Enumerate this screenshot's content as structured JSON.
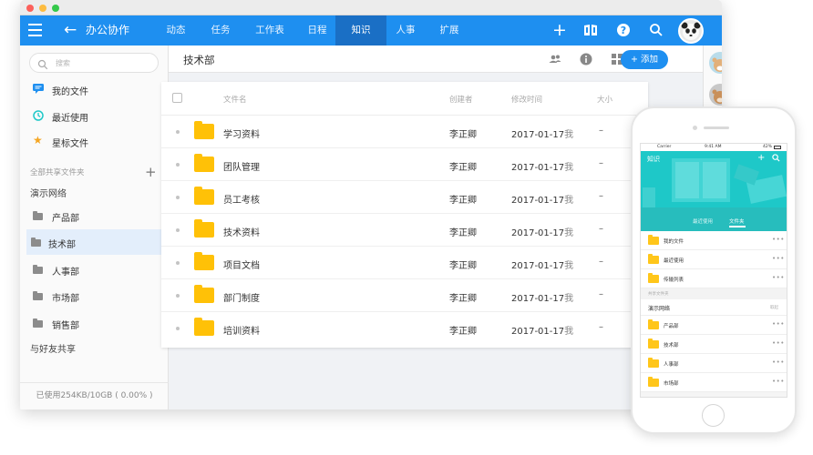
{
  "app": {
    "title": "办公协作",
    "nav_tabs": [
      {
        "label": "动态"
      },
      {
        "label": "任务"
      },
      {
        "label": "工作表"
      },
      {
        "label": "日程"
      },
      {
        "label": "知识",
        "active": true
      },
      {
        "label": "人事"
      },
      {
        "label": "扩展"
      }
    ],
    "accent_color": "#1e8ff0"
  },
  "sidebar": {
    "search_placeholder": "搜索",
    "quick_items": [
      {
        "label": "我的文件",
        "icon": "comment-icon"
      },
      {
        "label": "最近使用",
        "icon": "clock-icon"
      },
      {
        "label": "星标文件",
        "icon": "star-icon"
      }
    ],
    "shared_section_label": "全部共享文件夹",
    "network_label": "演示网络",
    "folders": [
      {
        "label": "产品部"
      },
      {
        "label": "技术部",
        "active": true
      },
      {
        "label": "人事部"
      },
      {
        "label": "市场部"
      },
      {
        "label": "销售部"
      }
    ],
    "friends_label": "与好友共享",
    "storage": "已使用254KB/10GB ( 0.00% )"
  },
  "content": {
    "folder_title": "技术部",
    "add_button": "添加",
    "columns": {
      "name": "文件名",
      "creator": "创建者",
      "modified": "修改时间",
      "size": "大小"
    },
    "rows": [
      {
        "name": "学习资料",
        "creator": "李正卿",
        "date": "2017-01-17",
        "by": "我",
        "size": "–"
      },
      {
        "name": "团队管理",
        "creator": "李正卿",
        "date": "2017-01-17",
        "by": "我",
        "size": "–"
      },
      {
        "name": "员工考核",
        "creator": "李正卿",
        "date": "2017-01-17",
        "by": "我",
        "size": "–"
      },
      {
        "name": "技术资料",
        "creator": "李正卿",
        "date": "2017-01-17",
        "by": "我",
        "size": "–"
      },
      {
        "name": "项目文档",
        "creator": "李正卿",
        "date": "2017-01-17",
        "by": "我",
        "size": "–"
      },
      {
        "name": "部门制度",
        "creator": "李正卿",
        "date": "2017-01-17",
        "by": "我",
        "size": "–"
      },
      {
        "name": "培训资料",
        "creator": "李正卿",
        "date": "2017-01-17",
        "by": "我",
        "size": "–"
      }
    ]
  },
  "mobile": {
    "status": {
      "carrier": "Carrier",
      "time": "9:41 AM",
      "battery": "42%"
    },
    "title": "知识",
    "tabs": [
      {
        "label": "最近使用"
      },
      {
        "label": "文件夹",
        "active": true
      }
    ],
    "quick_items": [
      {
        "label": "我的文件",
        "more": "•••"
      },
      {
        "label": "最近使用",
        "more": "•••"
      },
      {
        "label": "传输列表",
        "more": "•••"
      }
    ],
    "shared_label": "共享文件夹",
    "network": {
      "label": "演示网络",
      "action": "取起"
    },
    "folders": [
      {
        "label": "产品部",
        "more": "•••"
      },
      {
        "label": "技术部",
        "more": "•••"
      },
      {
        "label": "人事部",
        "more": "•••"
      },
      {
        "label": "市场部",
        "more": "•••"
      }
    ]
  }
}
